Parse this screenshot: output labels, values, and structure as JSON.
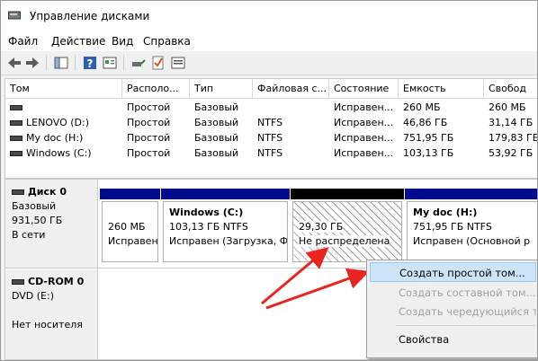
{
  "window": {
    "title": "Управление дисками"
  },
  "menu": [
    "Файл",
    "Действие",
    "Вид",
    "Справка"
  ],
  "toolbar": {
    "icons": [
      "back-icon",
      "forward-icon",
      "console-tree-icon",
      "help-icon",
      "properties-icon",
      "connect-icon",
      "check-icon",
      "settings-icon"
    ]
  },
  "volumes": {
    "columns": [
      "Том",
      "Располо...",
      "Тип",
      "Файловая с...",
      "Состояние",
      "Емкость",
      "Свобод"
    ],
    "rows": [
      [
        "",
        "Простой",
        "Базовый",
        "",
        "Исправен...",
        "260 МБ",
        "260 МБ"
      ],
      [
        "LENOVO (D:)",
        "Простой",
        "Базовый",
        "NTFS",
        "Исправен...",
        "46,86 ГБ",
        "31,14 ГБ"
      ],
      [
        "My doc (H:)",
        "Простой",
        "Базовый",
        "NTFS",
        "Исправен...",
        "751,95 ГБ",
        "179,83 ГБ"
      ],
      [
        "Windows (C:)",
        "Простой",
        "Базовый",
        "NTFS",
        "Исправен...",
        "103,13 ГБ",
        "53,92 ГБ"
      ]
    ]
  },
  "disk0": {
    "name": "Диск 0",
    "type": "Базовый",
    "size": "931,50 ГБ",
    "status": "В сети",
    "partitions": [
      {
        "title": "",
        "line1": "260 МБ",
        "line2": "Исправен"
      },
      {
        "title": "Windows  (C:)",
        "line1": "103,13 ГБ NTFS",
        "line2": "Исправен (Загрузка, Фа"
      },
      {
        "title": "",
        "line1": "29,30 ГБ",
        "line2": "Не распределена"
      },
      {
        "title": "My doc  (H:)",
        "line1": "751,95 ГБ NTFS",
        "line2": "Исправен (Основной р"
      }
    ]
  },
  "cdrom": {
    "name": "CD-ROM 0",
    "drive": "DVD (E:)",
    "status": "Нет носителя"
  },
  "context_menu": {
    "items": [
      "Создать простой том...",
      "Создать составной том...",
      "Создать чередующийся то",
      "Свойства"
    ]
  },
  "colors": {
    "primary_partition": "#000a8c",
    "unallocated": "#000000",
    "arrow": "#e8261f",
    "highlight": "#cce4f7"
  }
}
